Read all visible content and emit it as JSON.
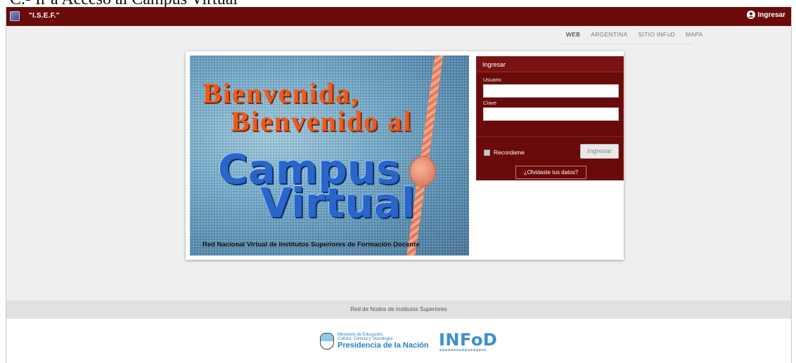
{
  "browser_caption": "C.- Ir a Acceso al Campus Virtual",
  "header": {
    "institution": "\"I.S.E.F.\"",
    "login_label": "Ingresar"
  },
  "nav": {
    "items": [
      "WEB",
      "ARGENTINA",
      "SITIO INFoD",
      "MAPA"
    ]
  },
  "banner": {
    "line1": "Bienvenida,",
    "line2": "Bienvenido al",
    "line3": "Campus",
    "line4": "Virtual",
    "tagline": "Red Nacional Virtual de Institutos Superiores de Formación Docente"
  },
  "login_box": {
    "title": "Ingresar",
    "username_label": "Usuario",
    "username_value": "",
    "password_label": "Clave",
    "password_value": "",
    "remember_label": "Recordame",
    "remember_checked": false,
    "submit_label": "Ingresar",
    "forgot_label": "¿Olvidaste tus datos?"
  },
  "footer": {
    "text": "Red de Nodos de Institutos Superiores"
  },
  "logos": {
    "ministry_line1": "Ministerio de Educación,",
    "ministry_line2": "Cultura, Ciencia y Tecnología",
    "ministry_line3": "Presidencia de la Nación",
    "infod": "INFoD"
  },
  "colors": {
    "brand_maroon": "#6b0a0a",
    "background": "#efefef",
    "footer_bar": "#e1e1e1",
    "infod_blue": "#3d8fcf"
  }
}
